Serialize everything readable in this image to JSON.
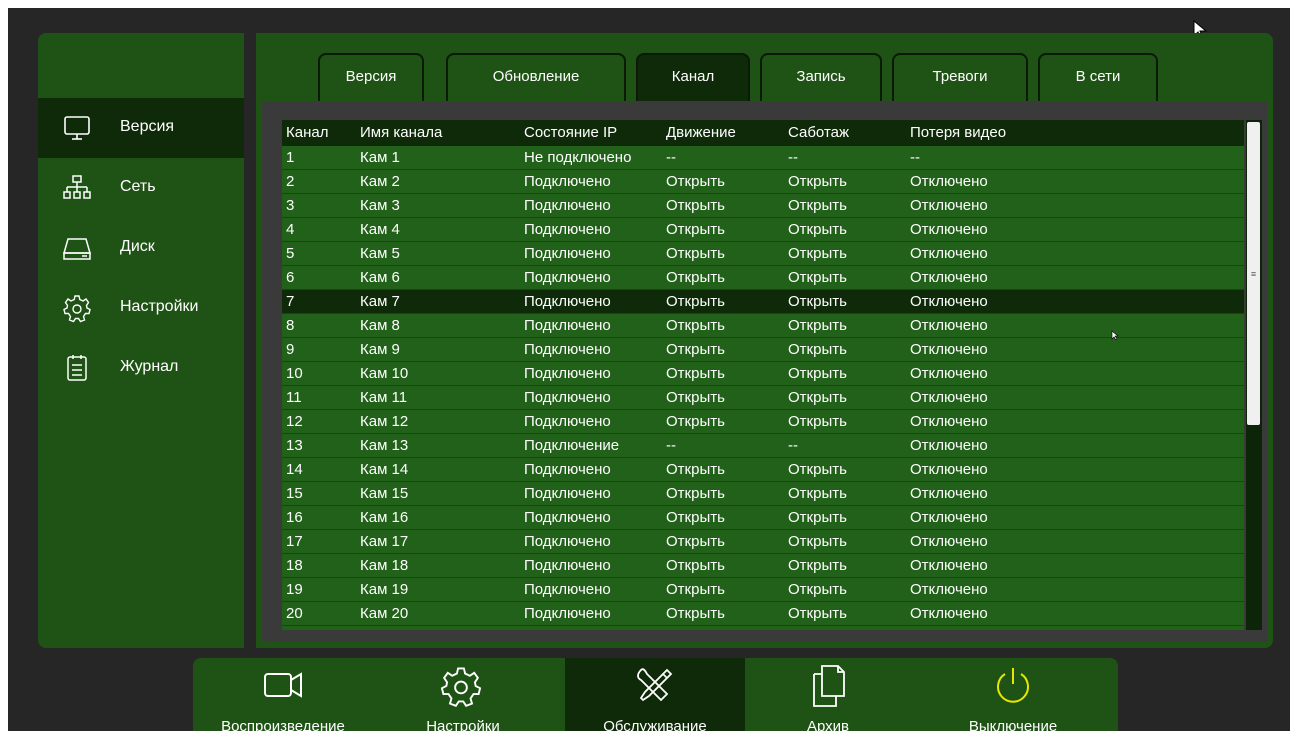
{
  "sidebar": {
    "items": [
      {
        "label": "Версия",
        "icon": "monitor-icon",
        "active": true
      },
      {
        "label": "Сеть",
        "icon": "network-icon",
        "active": false
      },
      {
        "label": "Диск",
        "icon": "disk-icon",
        "active": false
      },
      {
        "label": "Настройки",
        "icon": "gear-icon",
        "active": false
      },
      {
        "label": "Журнал",
        "icon": "log-icon",
        "active": false
      }
    ]
  },
  "tabs": [
    {
      "label": "Версия",
      "active": false
    },
    {
      "label": "Обновление",
      "active": false
    },
    {
      "label": "Канал",
      "active": true
    },
    {
      "label": "Запись",
      "active": false
    },
    {
      "label": "Тревоги",
      "active": false
    },
    {
      "label": "В сети",
      "active": false
    }
  ],
  "table": {
    "columns": [
      "Канал",
      "Имя канала",
      "Состояние IP",
      "Движение",
      "Саботаж",
      "Потеря видео"
    ],
    "selected_row": 7,
    "rows": [
      [
        "1",
        "Кам 1",
        "Не подключено",
        "--",
        "--",
        "--"
      ],
      [
        "2",
        "Кам 2",
        "Подключено",
        "Открыть",
        "Открыть",
        "Отключено"
      ],
      [
        "3",
        "Кам 3",
        "Подключено",
        "Открыть",
        "Открыть",
        "Отключено"
      ],
      [
        "4",
        "Кам 4",
        "Подключено",
        "Открыть",
        "Открыть",
        "Отключено"
      ],
      [
        "5",
        "Кам 5",
        "Подключено",
        "Открыть",
        "Открыть",
        "Отключено"
      ],
      [
        "6",
        "Кам 6",
        "Подключено",
        "Открыть",
        "Открыть",
        "Отключено"
      ],
      [
        "7",
        "Кам 7",
        "Подключено",
        "Открыть",
        "Открыть",
        "Отключено"
      ],
      [
        "8",
        "Кам 8",
        "Подключено",
        "Открыть",
        "Открыть",
        "Отключено"
      ],
      [
        "9",
        "Кам 9",
        "Подключено",
        "Открыть",
        "Открыть",
        "Отключено"
      ],
      [
        "10",
        "Кам 10",
        "Подключено",
        "Открыть",
        "Открыть",
        "Отключено"
      ],
      [
        "11",
        "Кам 11",
        "Подключено",
        "Открыть",
        "Открыть",
        "Отключено"
      ],
      [
        "12",
        "Кам 12",
        "Подключено",
        "Открыть",
        "Открыть",
        "Отключено"
      ],
      [
        "13",
        "Кам 13",
        "Подключение",
        "--",
        "--",
        "Отключено"
      ],
      [
        "14",
        "Кам 14",
        "Подключено",
        "Открыть",
        "Открыть",
        "Отключено"
      ],
      [
        "15",
        "Кам 15",
        "Подключено",
        "Открыть",
        "Открыть",
        "Отключено"
      ],
      [
        "16",
        "Кам 16",
        "Подключено",
        "Открыть",
        "Открыть",
        "Отключено"
      ],
      [
        "17",
        "Кам 17",
        "Подключено",
        "Открыть",
        "Открыть",
        "Отключено"
      ],
      [
        "18",
        "Кам 18",
        "Подключено",
        "Открыть",
        "Открыть",
        "Отключено"
      ],
      [
        "19",
        "Кам 19",
        "Подключено",
        "Открыть",
        "Открыть",
        "Отключено"
      ],
      [
        "20",
        "Кам 20",
        "Подключено",
        "Открыть",
        "Открыть",
        "Отключено"
      ]
    ]
  },
  "bottom_bar": {
    "items": [
      {
        "label": "Воспроизведение",
        "icon": "camera-icon",
        "active": false
      },
      {
        "label": "Настройки",
        "icon": "gear-icon",
        "active": false
      },
      {
        "label": "Обслуживание",
        "icon": "tools-icon",
        "active": true
      },
      {
        "label": "Архив",
        "icon": "files-icon",
        "active": false
      },
      {
        "label": "Выключение",
        "icon": "power-icon",
        "active": false
      }
    ]
  },
  "colors": {
    "panel_green": "#1f5316",
    "dark_green": "#0e2a09",
    "row_green": "#22611a",
    "power_yellow": "#e6e600"
  }
}
